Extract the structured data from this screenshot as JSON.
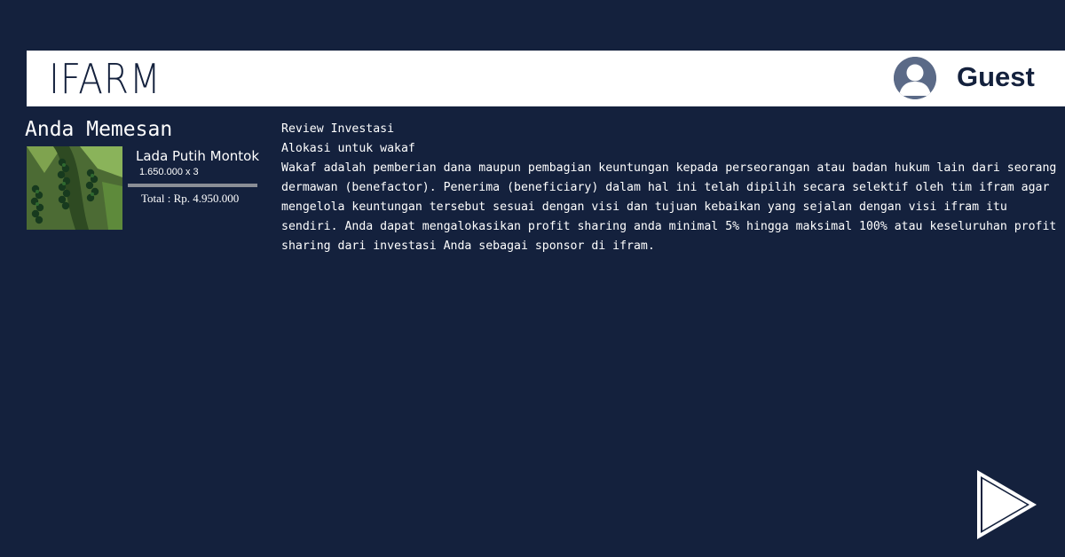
{
  "header": {
    "logo": "IFARM",
    "user_name": "Guest"
  },
  "order": {
    "heading": "Anda Memesan",
    "product_name": "Lada Putih Montok",
    "price_qty": "1.650.000 x 3",
    "total": "Total : Rp. 4.950.000"
  },
  "review": {
    "title": "Review Investasi",
    "subtitle": "Alokasi untuk wakaf",
    "body": "Wakaf adalah pemberian dana maupun pembagian keuntungan kepada perseorangan atau badan hukum lain dari seorang dermawan (benefactor). Penerima (beneficiary) dalam hal ini telah dipilih secara selektif oleh tim ifram agar mengelola keuntungan tersebut sesuai dengan visi dan tujuan kebaikan yang sejalan dengan visi ifram itu sendiri. Anda dapat mengalokasikan profit sharing anda minimal 5% hingga maksimal 100% atau keseluruhan profit sharing dari investasi Anda sebagai sponsor di ifram."
  },
  "icons": {
    "avatar": "user-avatar-icon",
    "next": "play-next-icon"
  },
  "colors": {
    "background": "#14213d",
    "header_bar": "#ffffff",
    "divider": "#8a8e96",
    "avatar": "#5b6a87"
  }
}
